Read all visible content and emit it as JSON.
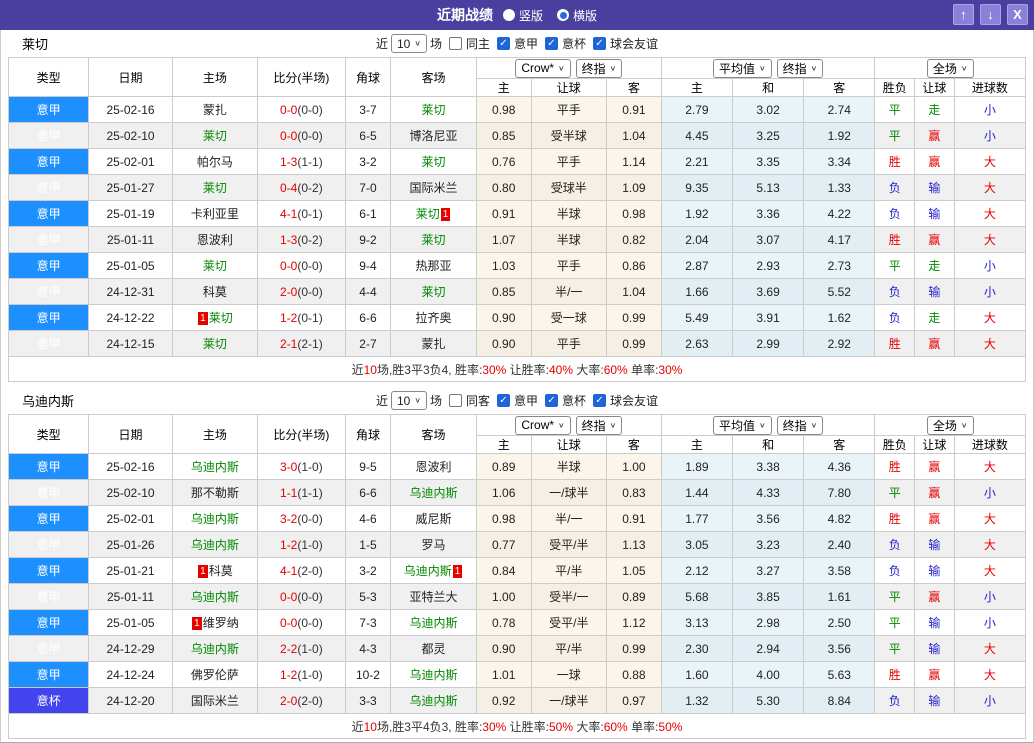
{
  "titlebar": {
    "title": "近期战绩",
    "radios": [
      {
        "label": "竖版",
        "checked": false
      },
      {
        "label": "横版",
        "checked": true
      }
    ],
    "buttons": {
      "up": "↑",
      "down": "↓",
      "close": "X"
    }
  },
  "colors": {
    "header_bg": "#4A3F9F",
    "league_badge": "#1E8FFF",
    "cup_badge": "#4444EE",
    "focus_team": "#008800",
    "win_red": "#E60000",
    "draw_green": "#008800",
    "lose_blue": "#2222CC"
  },
  "filter_labels": {
    "near": "近",
    "games": "场"
  },
  "table": {
    "columns": [
      "类型",
      "日期",
      "主场",
      "比分(半场)",
      "角球",
      "客场"
    ],
    "crow_select": "Crow*",
    "final_select": "终指",
    "avg_select": "平均值",
    "full_select": "全场",
    "crow_cols": [
      "主",
      "让球",
      "客"
    ],
    "avg_cols": [
      "主",
      "和",
      "客"
    ],
    "full_cols": [
      "胜负",
      "让球",
      "进球数"
    ]
  },
  "sections": [
    {
      "title": "莱切",
      "filter": {
        "count": "10",
        "same_label": "同主",
        "same_checked": false,
        "leagues": [
          "意甲",
          "意杯",
          "球会友谊"
        ]
      },
      "rows": [
        {
          "league": "意甲",
          "date": "25-02-16",
          "home": "蒙扎",
          "score": "0-0",
          "half": "(0-0)",
          "corner": "3-7",
          "away": "莱切",
          "away_focus": true,
          "odds": [
            "0.98",
            "平手",
            "0.91"
          ],
          "avg": [
            "2.79",
            "3.02",
            "2.74"
          ],
          "results": [
            "平",
            "走",
            "小"
          ]
        },
        {
          "league": "意甲",
          "date": "25-02-10",
          "home": "莱切",
          "home_focus": true,
          "score": "0-0",
          "half": "(0-0)",
          "corner": "6-5",
          "away": "博洛尼亚",
          "odds": [
            "0.85",
            "受半球",
            "1.04"
          ],
          "avg": [
            "4.45",
            "3.25",
            "1.92"
          ],
          "results": [
            "平",
            "赢",
            "小"
          ]
        },
        {
          "league": "意甲",
          "date": "25-02-01",
          "home": "帕尔马",
          "score": "1-3",
          "half": "(1-1)",
          "corner": "3-2",
          "away": "莱切",
          "away_focus": true,
          "odds": [
            "0.76",
            "平手",
            "1.14"
          ],
          "avg": [
            "2.21",
            "3.35",
            "3.34"
          ],
          "results": [
            "胜",
            "赢",
            "大"
          ]
        },
        {
          "league": "意甲",
          "date": "25-01-27",
          "home": "莱切",
          "home_focus": true,
          "score": "0-4",
          "half": "(0-2)",
          "corner": "7-0",
          "away": "国际米兰",
          "odds": [
            "0.80",
            "受球半",
            "1.09"
          ],
          "avg": [
            "9.35",
            "5.13",
            "1.33"
          ],
          "results": [
            "负",
            "输",
            "大"
          ]
        },
        {
          "league": "意甲",
          "date": "25-01-19",
          "home": "卡利亚里",
          "score": "4-1",
          "half": "(0-1)",
          "corner": "6-1",
          "away": "莱切",
          "away_focus": true,
          "away_card": true,
          "odds": [
            "0.91",
            "半球",
            "0.98"
          ],
          "avg": [
            "1.92",
            "3.36",
            "4.22"
          ],
          "results": [
            "负",
            "输",
            "大"
          ]
        },
        {
          "league": "意甲",
          "date": "25-01-11",
          "home": "恩波利",
          "score": "1-3",
          "half": "(0-2)",
          "corner": "9-2",
          "away": "莱切",
          "away_focus": true,
          "odds": [
            "1.07",
            "半球",
            "0.82"
          ],
          "avg": [
            "2.04",
            "3.07",
            "4.17"
          ],
          "results": [
            "胜",
            "赢",
            "大"
          ]
        },
        {
          "league": "意甲",
          "date": "25-01-05",
          "home": "莱切",
          "home_focus": true,
          "score": "0-0",
          "half": "(0-0)",
          "corner": "9-4",
          "away": "热那亚",
          "odds": [
            "1.03",
            "平手",
            "0.86"
          ],
          "avg": [
            "2.87",
            "2.93",
            "2.73"
          ],
          "results": [
            "平",
            "走",
            "小"
          ]
        },
        {
          "league": "意甲",
          "date": "24-12-31",
          "home": "科莫",
          "score": "2-0",
          "half": "(0-0)",
          "corner": "4-4",
          "away": "莱切",
          "away_focus": true,
          "odds": [
            "0.85",
            "半/一",
            "1.04"
          ],
          "avg": [
            "1.66",
            "3.69",
            "5.52"
          ],
          "results": [
            "负",
            "输",
            "小"
          ]
        },
        {
          "league": "意甲",
          "date": "24-12-22",
          "home": "莱切",
          "home_focus": true,
          "home_card": true,
          "score": "1-2",
          "half": "(0-1)",
          "corner": "6-6",
          "away": "拉齐奥",
          "odds": [
            "0.90",
            "受一球",
            "0.99"
          ],
          "avg": [
            "5.49",
            "3.91",
            "1.62"
          ],
          "results": [
            "负",
            "走",
            "大"
          ]
        },
        {
          "league": "意甲",
          "date": "24-12-15",
          "home": "莱切",
          "home_focus": true,
          "score": "2-1",
          "half": "(2-1)",
          "corner": "2-7",
          "away": "蒙扎",
          "odds": [
            "0.90",
            "平手",
            "0.99"
          ],
          "avg": [
            "2.63",
            "2.99",
            "2.92"
          ],
          "results": [
            "胜",
            "赢",
            "大"
          ]
        }
      ],
      "summary": [
        [
          "近",
          "b"
        ],
        [
          "10",
          "r"
        ],
        [
          "场,胜3平3负4, 胜率:",
          "b"
        ],
        [
          "30%",
          "r"
        ],
        [
          " 让胜率:",
          "b"
        ],
        [
          "40%",
          "r"
        ],
        [
          " 大率:",
          "b"
        ],
        [
          "60%",
          "r"
        ],
        [
          " 单率:",
          "b"
        ],
        [
          "30%",
          "r"
        ]
      ]
    },
    {
      "title": "乌迪内斯",
      "filter": {
        "count": "10",
        "same_label": "同客",
        "same_checked": false,
        "leagues": [
          "意甲",
          "意杯",
          "球会友谊"
        ]
      },
      "rows": [
        {
          "league": "意甲",
          "date": "25-02-16",
          "home": "乌迪内斯",
          "home_focus": true,
          "score": "3-0",
          "half": "(1-0)",
          "corner": "9-5",
          "away": "恩波利",
          "odds": [
            "0.89",
            "半球",
            "1.00"
          ],
          "avg": [
            "1.89",
            "3.38",
            "4.36"
          ],
          "results": [
            "胜",
            "赢",
            "大"
          ]
        },
        {
          "league": "意甲",
          "date": "25-02-10",
          "home": "那不勒斯",
          "score": "1-1",
          "half": "(1-1)",
          "corner": "6-6",
          "away": "乌迪内斯",
          "away_focus": true,
          "odds": [
            "1.06",
            "一/球半",
            "0.83"
          ],
          "avg": [
            "1.44",
            "4.33",
            "7.80"
          ],
          "results": [
            "平",
            "赢",
            "小"
          ]
        },
        {
          "league": "意甲",
          "date": "25-02-01",
          "home": "乌迪内斯",
          "home_focus": true,
          "score": "3-2",
          "half": "(0-0)",
          "corner": "4-6",
          "away": "威尼斯",
          "odds": [
            "0.98",
            "半/一",
            "0.91"
          ],
          "avg": [
            "1.77",
            "3.56",
            "4.82"
          ],
          "results": [
            "胜",
            "赢",
            "大"
          ]
        },
        {
          "league": "意甲",
          "date": "25-01-26",
          "home": "乌迪内斯",
          "home_focus": true,
          "score": "1-2",
          "half": "(1-0)",
          "corner": "1-5",
          "away": "罗马",
          "odds": [
            "0.77",
            "受平/半",
            "1.13"
          ],
          "avg": [
            "3.05",
            "3.23",
            "2.40"
          ],
          "results": [
            "负",
            "输",
            "大"
          ]
        },
        {
          "league": "意甲",
          "date": "25-01-21",
          "home": "科莫",
          "home_card": true,
          "score": "4-1",
          "half": "(2-0)",
          "corner": "3-2",
          "away": "乌迪内斯",
          "away_focus": true,
          "away_card": true,
          "odds": [
            "0.84",
            "平/半",
            "1.05"
          ],
          "avg": [
            "2.12",
            "3.27",
            "3.58"
          ],
          "results": [
            "负",
            "输",
            "大"
          ]
        },
        {
          "league": "意甲",
          "date": "25-01-11",
          "home": "乌迪内斯",
          "home_focus": true,
          "score": "0-0",
          "half": "(0-0)",
          "corner": "5-3",
          "away": "亚特兰大",
          "odds": [
            "1.00",
            "受半/一",
            "0.89"
          ],
          "avg": [
            "5.68",
            "3.85",
            "1.61"
          ],
          "results": [
            "平",
            "赢",
            "小"
          ]
        },
        {
          "league": "意甲",
          "date": "25-01-05",
          "home": "维罗纳",
          "home_card": true,
          "score": "0-0",
          "half": "(0-0)",
          "corner": "7-3",
          "away": "乌迪内斯",
          "away_focus": true,
          "odds": [
            "0.78",
            "受平/半",
            "1.12"
          ],
          "avg": [
            "3.13",
            "2.98",
            "2.50"
          ],
          "results": [
            "平",
            "输",
            "小"
          ]
        },
        {
          "league": "意甲",
          "date": "24-12-29",
          "home": "乌迪内斯",
          "home_focus": true,
          "score": "2-2",
          "half": "(1-0)",
          "corner": "4-3",
          "away": "都灵",
          "odds": [
            "0.90",
            "平/半",
            "0.99"
          ],
          "avg": [
            "2.30",
            "2.94",
            "3.56"
          ],
          "results": [
            "平",
            "输",
            "大"
          ]
        },
        {
          "league": "意甲",
          "date": "24-12-24",
          "home": "佛罗伦萨",
          "score": "1-2",
          "half": "(1-0)",
          "corner": "10-2",
          "away": "乌迪内斯",
          "away_focus": true,
          "odds": [
            "1.01",
            "一球",
            "0.88"
          ],
          "avg": [
            "1.60",
            "4.00",
            "5.63"
          ],
          "results": [
            "胜",
            "赢",
            "大"
          ]
        },
        {
          "league": "意杯",
          "cup": true,
          "date": "24-12-20",
          "home": "国际米兰",
          "score": "2-0",
          "half": "(2-0)",
          "corner": "3-3",
          "away": "乌迪内斯",
          "away_focus": true,
          "odds": [
            "0.92",
            "一/球半",
            "0.97"
          ],
          "avg": [
            "1.32",
            "5.30",
            "8.84"
          ],
          "results": [
            "负",
            "输",
            "小"
          ]
        }
      ],
      "summary": [
        [
          "近",
          "b"
        ],
        [
          "10",
          "r"
        ],
        [
          "场,胜3平4负3, 胜率:",
          "b"
        ],
        [
          "30%",
          "r"
        ],
        [
          " 让胜率:",
          "b"
        ],
        [
          "50%",
          "r"
        ],
        [
          " 大率:",
          "b"
        ],
        [
          "60%",
          "r"
        ],
        [
          " 单率:",
          "b"
        ],
        [
          "50%",
          "r"
        ]
      ]
    }
  ]
}
